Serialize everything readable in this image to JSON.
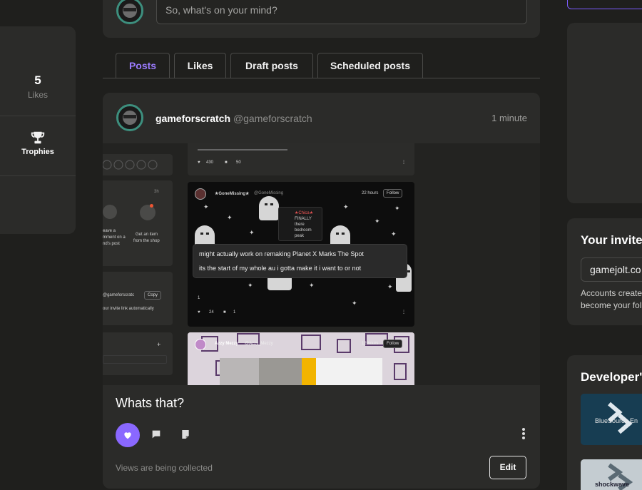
{
  "composer": {
    "placeholder": "So, what's on your mind?"
  },
  "stats": {
    "likes_count": "5",
    "likes_label": "Likes",
    "trophies_label": "Trophies"
  },
  "tabs": [
    {
      "label": "Posts",
      "active": true
    },
    {
      "label": "Likes",
      "active": false
    },
    {
      "label": "Draft posts",
      "active": false
    },
    {
      "label": "Scheduled posts",
      "active": false
    }
  ],
  "post": {
    "display_name": "gameforscratch",
    "username": "@gameforscratch",
    "time": "1 minute",
    "title": "Whats that?",
    "views_text": "Views are being collected",
    "edit_label": "Edit",
    "image": {
      "left_panel": {
        "time": "3h",
        "card1_text": [
          "eave a",
          "mment on a",
          "nd's post"
        ],
        "card2_text": [
          "Get an item",
          "from the shop"
        ],
        "invite_user": "@gameforscratc",
        "copy_label": "Copy",
        "invite_desc": "our invite link automatically",
        "plus": "+"
      },
      "feed": {
        "post1": {
          "likes": "430",
          "comments": "50"
        },
        "post2": {
          "name": "★GoneMissing★",
          "handle": "@GoneMissing",
          "time": "22 hours",
          "follow": "Follow",
          "inner_name": "★Chica★",
          "inner_lines": [
            "FINALLY",
            "there",
            "bedroom",
            "peak"
          ],
          "text_line1": "might actually work on remaking Planet X Marks The Spot",
          "text_line2": "its the start of my whole au i gotta make it i want to or not",
          "likes": "24",
          "comments": "1",
          "small_count": "1"
        },
        "post3": {
          "name": "Azzy Mezzy",
          "handle": "@Azzy_Mezzy",
          "time": "12 hours",
          "follow": "Follow"
        }
      }
    }
  },
  "right": {
    "invite_title": "Your invite",
    "invite_value": "gamejolt.co",
    "invite_desc_line1": "Accounts create",
    "invite_desc_line2": "become your fol",
    "dev_title": "Developer's",
    "dev_items": [
      "BlueSource En",
      "shockwave"
    ]
  },
  "colors": {
    "background": "#1f1f1d",
    "card": "#2b2b29",
    "accent": "#8a68ff",
    "active_tab": "#9b7bff"
  }
}
